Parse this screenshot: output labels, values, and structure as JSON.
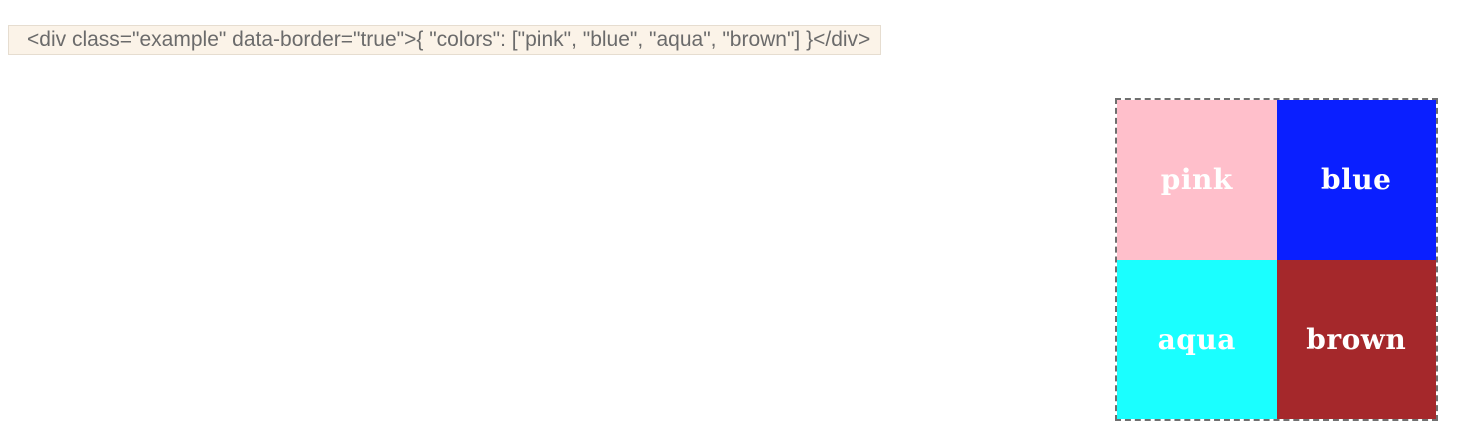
{
  "code_sample": {
    "text": "<div class=\"example\" data-border=\"true\">{ \"colors\": [\"pink\", \"blue\", \"aqua\", \"brown\"] }</div>"
  },
  "example": {
    "swatches": [
      {
        "label": "pink",
        "color": "#ffbfcb"
      },
      {
        "label": "blue",
        "color": "#0a1fff"
      },
      {
        "label": "aqua",
        "color": "#1affff"
      },
      {
        "label": "brown",
        "color": "#a5282b"
      }
    ]
  }
}
